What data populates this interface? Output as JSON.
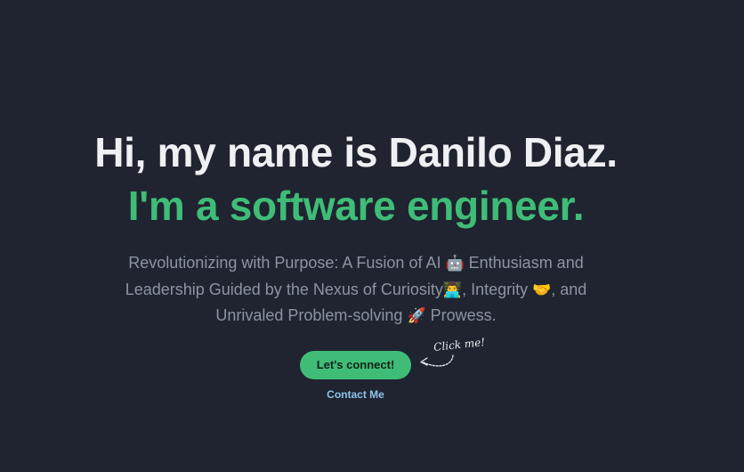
{
  "hero": {
    "headline": "Hi, my name is Danilo Diaz.",
    "subheadline": "I'm a software engineer."
  },
  "tagline": {
    "part1": "Revolutionizing with Purpose: A Fusion of AI ",
    "emoji_robot": "🤖",
    "part2": " Enthusiasm and Leadership Guided by the Nexus of Curiosity",
    "emoji_technologist": "👨‍💻",
    "part3": ", Integrity ",
    "emoji_handshake": "🤝",
    "part4": ", and Unrivaled Problem-solving ",
    "emoji_rocket": "🚀",
    "part5": " Prowess."
  },
  "cta": {
    "connect_label": "Let's connect!",
    "contact_label": "Contact Me",
    "hint_label": "Click me!"
  },
  "colors": {
    "background": "#1f2430",
    "accent": "#3fbd77",
    "link": "#8ec5ea",
    "muted_text": "#8c94a4"
  }
}
